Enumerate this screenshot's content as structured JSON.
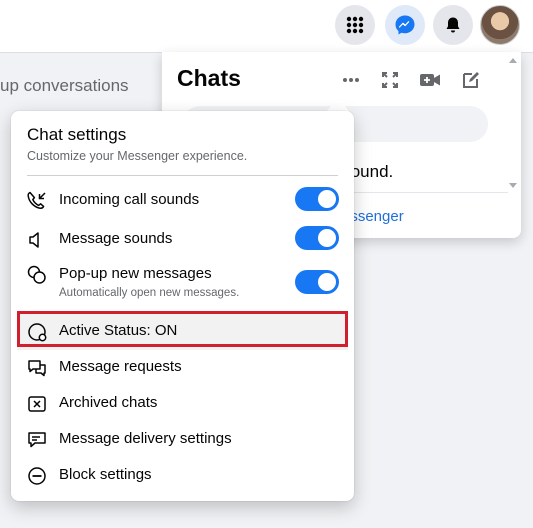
{
  "topbar": {
    "buttons": [
      {
        "name": "menu-grid-button",
        "icon": "grid-icon"
      },
      {
        "name": "messenger-button",
        "icon": "messenger-icon",
        "active_color": "#1877f2"
      },
      {
        "name": "notifications-button",
        "icon": "bell-icon"
      }
    ],
    "avatar": "account-avatar"
  },
  "background": {
    "partial_text": "up conversations"
  },
  "chats_panel": {
    "title": "Chats",
    "icons": [
      "more-icon",
      "expand-icon",
      "new-room-icon",
      "compose-icon"
    ],
    "no_results_text": "found.",
    "see_all_text": "essenger",
    "link_color": "#216fdb"
  },
  "chat_settings": {
    "title": "Chat settings",
    "subtitle": "Customize your Messenger experience.",
    "toggle_color": "#1877f2",
    "items": [
      {
        "label": "Incoming call sounds",
        "icon": "incoming-call-icon",
        "toggle": true
      },
      {
        "label": "Message sounds",
        "icon": "speaker-icon",
        "toggle": true
      },
      {
        "label": "Pop-up new messages",
        "sublabel": "Automatically open new messages.",
        "icon": "popup-messages-icon",
        "toggle": true
      },
      {
        "label": "Active Status: ON",
        "icon": "active-status-icon",
        "highlighted": true
      },
      {
        "label": "Message requests",
        "icon": "message-requests-icon"
      },
      {
        "label": "Archived chats",
        "icon": "archive-icon"
      },
      {
        "label": "Message delivery settings",
        "icon": "delivery-settings-icon"
      },
      {
        "label": "Block settings",
        "icon": "block-icon"
      }
    ],
    "highlight_border_color": "#d0202e"
  }
}
